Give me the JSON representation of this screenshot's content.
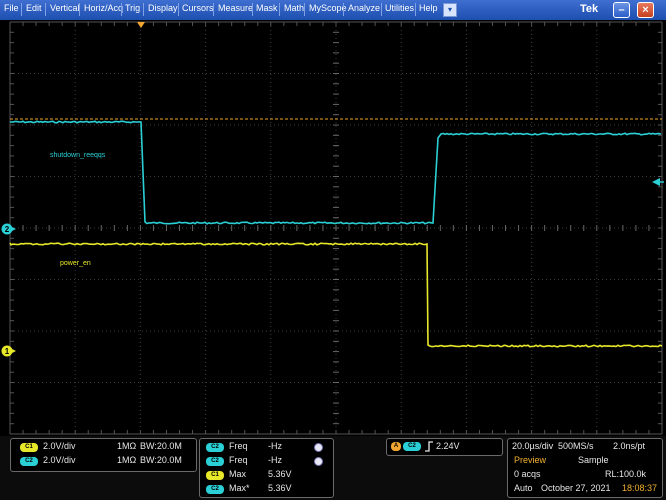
{
  "menu": {
    "items": [
      "File",
      "Edit",
      "Vertical",
      "Horiz/Acq",
      "Trig",
      "Display",
      "Cursors",
      "Measure",
      "Mask",
      "Math",
      "MyScope",
      "Analyze",
      "Utilities",
      "Help"
    ],
    "brand": "Tek",
    "dropdown": "▾",
    "minimize": "–",
    "close": "×"
  },
  "channels": {
    "ch1_label": "power_en",
    "ch2_label": "shutdown_reeqqs",
    "ch1_marker": "1",
    "ch2_marker": "2"
  },
  "colors": {
    "ch1": "#e8e82a",
    "ch2": "#2ad0d6",
    "trigger": "#f2a531",
    "grid": "#3c3c3c"
  },
  "panel": {
    "ch1_badge": "C1",
    "ch2_badge": "C2",
    "ch1_scale": "2.0V/div",
    "ch2_scale": "2.0V/div",
    "ch1_coupling": "1MΩ",
    "ch2_coupling": "1MΩ",
    "ch1_bw": "BW:20.0M",
    "ch2_bw": "BW:20.0M",
    "measurements": [
      {
        "badge": "C2",
        "name": "Freq",
        "value": "-Hz"
      },
      {
        "badge": "C2",
        "name": "Freq",
        "value": "-Hz"
      },
      {
        "badge": "C1",
        "name": "Max",
        "value": "5.36V"
      },
      {
        "badge": "C2",
        "name": "Max*",
        "value": "5.36V"
      }
    ],
    "trigger_mode_badge": "A",
    "trigger_source_badge": "C2",
    "trigger_level": "2.24V",
    "timebase": "20.0µs/div",
    "sample_rate": "500MS/s",
    "resolution": "2.0ns/pt",
    "state": "Preview",
    "acq_mode": "Sample",
    "acqs": "0 acqs",
    "record_length": "RL:100.0k",
    "run_mode": "Auto",
    "date": "October 27, 2021",
    "time": "18:08:37"
  }
}
